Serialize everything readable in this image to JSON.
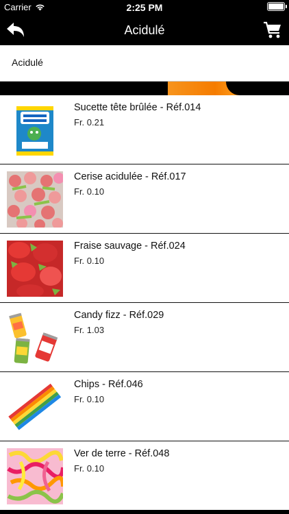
{
  "status": {
    "carrier": "Carrier",
    "time": "2:25 PM"
  },
  "nav": {
    "title": "Acidulé",
    "back_icon": "back-arrow-icon",
    "cart_icon": "cart-icon"
  },
  "section": {
    "title": "Acidulé"
  },
  "products": [
    {
      "title": "Sucette tête brûlée - Réf.014",
      "price": "Fr. 0.21",
      "image": "box-product-image"
    },
    {
      "title": "Cerise acidulée - Réf.017",
      "price": "Fr. 0.10",
      "image": "sour-cherry-image"
    },
    {
      "title": "Fraise sauvage - Réf.024",
      "price": "Fr. 0.10",
      "image": "strawberry-image"
    },
    {
      "title": "Candy fizz - Réf.029",
      "price": "Fr. 1.03",
      "image": "cans-image"
    },
    {
      "title": "Chips - Réf.046",
      "price": "Fr. 0.10",
      "image": "rainbow-strip-image"
    },
    {
      "title": "Ver de terre - Réf.048",
      "price": "Fr. 0.10",
      "image": "worms-image"
    }
  ]
}
